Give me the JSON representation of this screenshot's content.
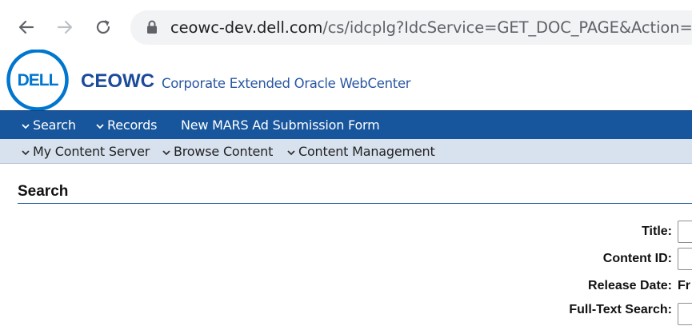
{
  "browser": {
    "url_host": "ceowc-dev.dell.com",
    "url_path": "/cs/idcplg?IdcService=GET_DOC_PAGE&Action=Ge"
  },
  "header": {
    "logo_text": "DELL",
    "brand": "CEOWC",
    "subtitle": "Corporate Extended Oracle WebCenter"
  },
  "nav_primary": {
    "items": [
      {
        "label": "Search",
        "icon": "chevron-down-icon"
      },
      {
        "label": "Records",
        "icon": "chevron-down-icon"
      },
      {
        "label": "New MARS Ad Submission Form"
      }
    ]
  },
  "nav_secondary": {
    "items": [
      {
        "label": "My Content Server",
        "icon": "chevron-down-icon"
      },
      {
        "label": "Browse Content",
        "icon": "chevron-down-icon"
      },
      {
        "label": "Content Management",
        "icon": "chevron-down-icon"
      }
    ]
  },
  "main": {
    "title": "Search",
    "fields": [
      {
        "label": "Title:"
      },
      {
        "label": "Content ID:"
      },
      {
        "label": "Release Date:",
        "value_text": "Fr"
      },
      {
        "label": "Full-Text Search:"
      }
    ]
  },
  "colors": {
    "nav_primary_bg": "#17559c",
    "nav_secondary_bg": "#d8e2ef",
    "brand_blue": "#1b4b9b"
  }
}
